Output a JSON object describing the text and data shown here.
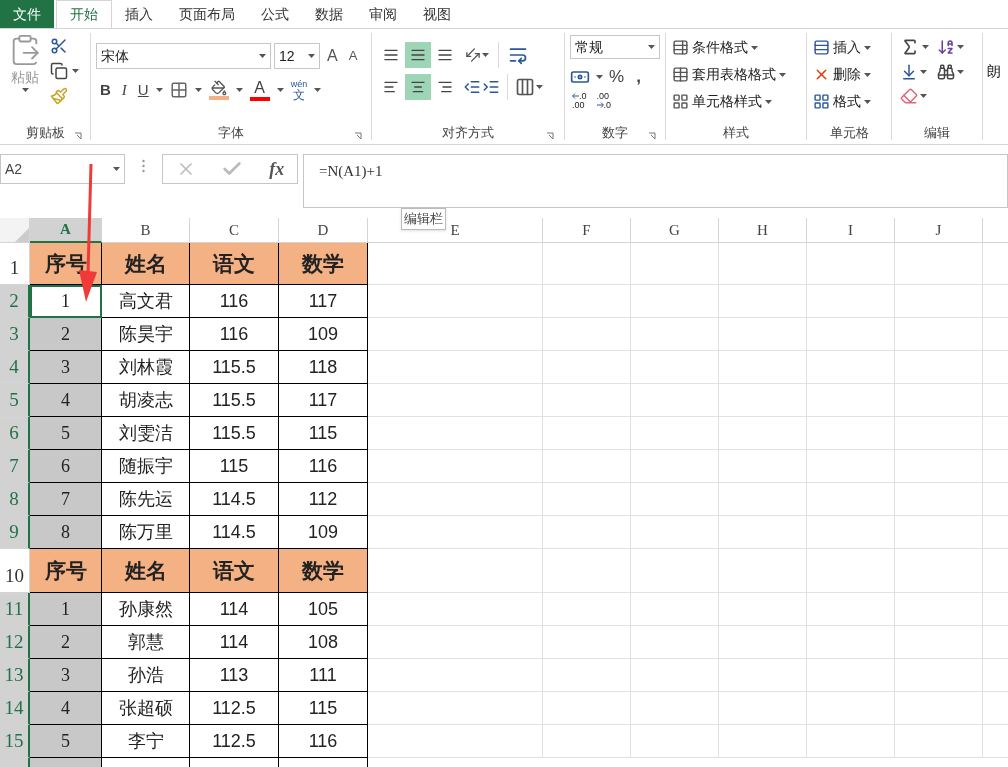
{
  "menu_tabs": [
    {
      "label": "文件",
      "selected": false,
      "kind": "file"
    },
    {
      "label": "开始",
      "selected": true,
      "kind": "tab"
    },
    {
      "label": "插入",
      "selected": false,
      "kind": "tab"
    },
    {
      "label": "页面布局",
      "selected": false,
      "kind": "tab"
    },
    {
      "label": "公式",
      "selected": false,
      "kind": "tab"
    },
    {
      "label": "数据",
      "selected": false,
      "kind": "tab"
    },
    {
      "label": "审阅",
      "selected": false,
      "kind": "tab"
    },
    {
      "label": "视图",
      "selected": false,
      "kind": "tab"
    }
  ],
  "ribbon": {
    "clipboard": {
      "paste": "粘贴",
      "label": "剪贴板"
    },
    "font": {
      "name": "宋体",
      "size": "12",
      "grow": "A",
      "shrink": "A",
      "bold": "B",
      "italic": "I",
      "underline": "U",
      "font_color": "A",
      "phonetic_top": "wén",
      "phonetic_bottom": "文",
      "label": "字体"
    },
    "alignment": {
      "label": "对齐方式",
      "top_buttons": [
        {
          "selected": false
        },
        {
          "selected": true
        },
        {
          "selected": false
        }
      ],
      "bottom_buttons": [
        {
          "selected": false
        },
        {
          "selected": true
        },
        {
          "selected": false
        }
      ]
    },
    "number": {
      "format": "常规",
      "percent": "%",
      "comma": ",",
      "increase_decimal": [
        ".0",
        ".00"
      ],
      "decrease_decimal": [
        ".00",
        ".0"
      ],
      "label": "数字"
    },
    "styles": {
      "items": [
        "条件格式",
        "套用表格格式",
        "单元格样式"
      ],
      "label": "样式"
    },
    "cells": {
      "items": [
        "插入",
        "删除",
        "格式"
      ],
      "label": "单元格"
    },
    "editing": {
      "label": "编辑"
    },
    "read_aloud": "朗"
  },
  "name_box": "A2",
  "formula_bar": {
    "fx": "fx",
    "formula": "=N(A1)+1",
    "tooltip": "编辑栏"
  },
  "columns": [
    {
      "label": "A",
      "selected": true
    },
    {
      "label": "B",
      "selected": false
    },
    {
      "label": "C",
      "selected": false
    },
    {
      "label": "D",
      "selected": false
    },
    {
      "label": "E",
      "selected": false
    },
    {
      "label": "F",
      "selected": false
    },
    {
      "label": "G",
      "selected": false
    },
    {
      "label": "H",
      "selected": false
    },
    {
      "label": "I",
      "selected": false
    },
    {
      "label": "J",
      "selected": false
    }
  ],
  "rows": [
    {
      "number": "1",
      "kind": "header",
      "selected": false,
      "cells": [
        "序号",
        "姓名",
        "语文",
        "数学"
      ]
    },
    {
      "number": "2",
      "kind": "data",
      "selected": true,
      "active": true,
      "cells": [
        "1",
        "高文君",
        "116",
        "117"
      ]
    },
    {
      "number": "3",
      "kind": "data",
      "selected": true,
      "active": false,
      "cells": [
        "2",
        "陈昊宇",
        "116",
        "109"
      ]
    },
    {
      "number": "4",
      "kind": "data",
      "selected": true,
      "active": false,
      "cells": [
        "3",
        "刘林霞",
        "115.5",
        "118"
      ]
    },
    {
      "number": "5",
      "kind": "data",
      "selected": true,
      "active": false,
      "cells": [
        "4",
        "胡凌志",
        "115.5",
        "117"
      ]
    },
    {
      "number": "6",
      "kind": "data",
      "selected": true,
      "active": false,
      "cells": [
        "5",
        "刘雯洁",
        "115.5",
        "115"
      ]
    },
    {
      "number": "7",
      "kind": "data",
      "selected": true,
      "active": false,
      "cells": [
        "6",
        "随振宇",
        "115",
        "116"
      ]
    },
    {
      "number": "8",
      "kind": "data",
      "selected": true,
      "active": false,
      "cells": [
        "7",
        "陈先运",
        "114.5",
        "112"
      ]
    },
    {
      "number": "9",
      "kind": "data",
      "selected": true,
      "active": false,
      "cells": [
        "8",
        "陈万里",
        "114.5",
        "109"
      ]
    },
    {
      "number": "10",
      "kind": "header",
      "selected": false,
      "cells": [
        "序号",
        "姓名",
        "语文",
        "数学"
      ]
    },
    {
      "number": "11",
      "kind": "data",
      "selected": true,
      "active": false,
      "cells": [
        "1",
        "孙康然",
        "114",
        "105"
      ]
    },
    {
      "number": "12",
      "kind": "data",
      "selected": true,
      "active": false,
      "cells": [
        "2",
        "郭慧",
        "114",
        "108"
      ]
    },
    {
      "number": "13",
      "kind": "data",
      "selected": true,
      "active": false,
      "cells": [
        "3",
        "孙浩",
        "113",
        "111"
      ]
    },
    {
      "number": "14",
      "kind": "data",
      "selected": true,
      "active": false,
      "cells": [
        "4",
        "张超硕",
        "112.5",
        "115"
      ]
    },
    {
      "number": "15",
      "kind": "data",
      "selected": true,
      "active": false,
      "cells": [
        "5",
        "李宁",
        "112.5",
        "116"
      ]
    }
  ]
}
